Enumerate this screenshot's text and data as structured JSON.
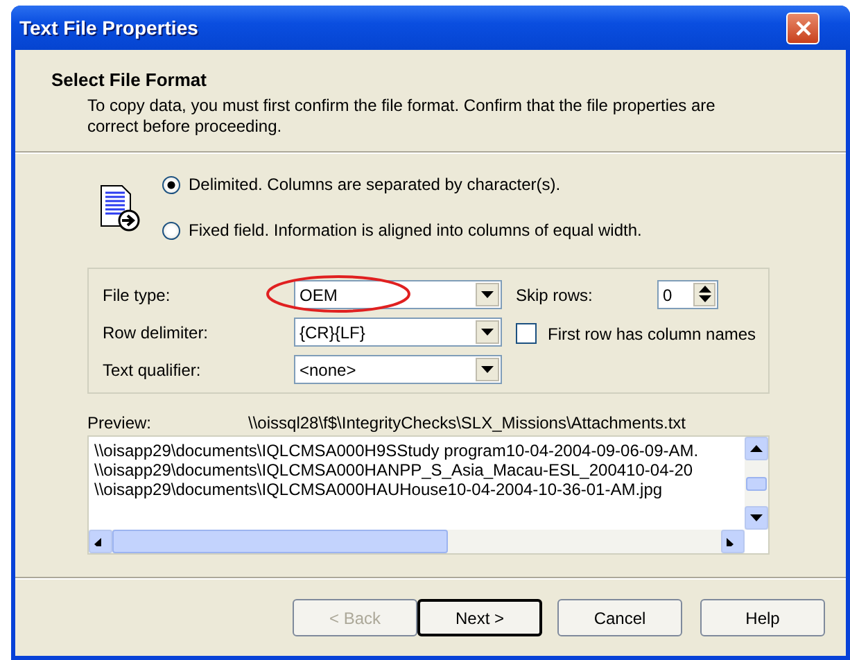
{
  "window": {
    "title": "Text File Properties"
  },
  "header": {
    "title": "Select File Format",
    "description": "To copy data, you must first confirm the file format. Confirm that the file properties are correct before proceeding."
  },
  "format_options": [
    {
      "label": "Delimited. Columns are separated by character(s).",
      "selected": true
    },
    {
      "label": "Fixed field. Information is aligned into columns of equal width.",
      "selected": false
    }
  ],
  "fields": [
    {
      "label": "File type:",
      "value": "OEM",
      "highlighted": true
    },
    {
      "label": "Row delimiter:",
      "value": "{CR}{LF}",
      "highlighted": false
    },
    {
      "label": "Text qualifier:",
      "value": "<none>",
      "highlighted": false
    }
  ],
  "skip_rows": {
    "label": "Skip rows:",
    "value": "0"
  },
  "first_row_names": {
    "label": "First row has column names",
    "checked": false
  },
  "preview": {
    "label": "Preview:",
    "path": "\\\\oissql28\\f$\\IntegrityChecks\\SLX_Missions\\Attachments.txt",
    "lines": [
      "\\\\oisapp29\\documents\\IQLCMSA000H9SStudy program10-04-2004-09-06-09-AM.",
      "\\\\oisapp29\\documents\\IQLCMSA000HANPP_S_Asia_Macau-ESL_200410-04-20",
      "\\\\oisapp29\\documents\\IQLCMSA000HAUHouse10-04-2004-10-36-01-AM.jpg"
    ]
  },
  "buttons": [
    {
      "label": "< Back",
      "disabled": true,
      "default": false
    },
    {
      "label": "Next >",
      "disabled": false,
      "default": true
    },
    {
      "label": "Cancel",
      "disabled": false,
      "default": false
    },
    {
      "label": "Help",
      "disabled": false,
      "default": false
    }
  ]
}
